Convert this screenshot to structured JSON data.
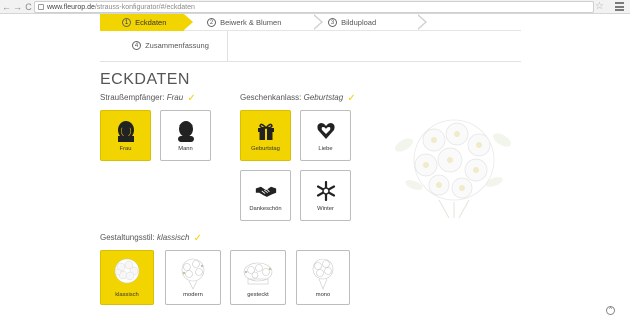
{
  "browser": {
    "back_glyph": "←",
    "forward_glyph": "→",
    "reload_glyph": "C",
    "url_host": "www.fleurop.de",
    "url_path": "/strauss-konfigurator/#/eckdaten",
    "star_glyph": "☆"
  },
  "stepper": {
    "steps": [
      {
        "num": "1",
        "label": "Eckdaten",
        "active": true
      },
      {
        "num": "2",
        "label": "Beiwerk & Blumen",
        "active": false
      },
      {
        "num": "3",
        "label": "Bildupload",
        "active": false
      },
      {
        "num": "4",
        "label": "Zusammenfassung",
        "active": false
      }
    ]
  },
  "page": {
    "title": "ECKDATEN"
  },
  "recipient": {
    "label": "Straußempfänger:",
    "value": "Frau",
    "options": [
      {
        "label": "Frau",
        "icon": "woman-icon",
        "selected": true
      },
      {
        "label": "Mann",
        "icon": "man-icon",
        "selected": false
      }
    ]
  },
  "occasion": {
    "label": "Geschenkanlass:",
    "value": "Geburtstag",
    "options": [
      {
        "label": "Geburtstag",
        "icon": "gift-icon",
        "selected": true
      },
      {
        "label": "Liebe",
        "icon": "heart-icon",
        "selected": false
      },
      {
        "label": "Dankeschön",
        "icon": "handshake-icon",
        "selected": false
      },
      {
        "label": "Winter",
        "icon": "snowflake-icon",
        "selected": false
      }
    ]
  },
  "style": {
    "label": "Gestaltungsstil:",
    "value": "klassisch",
    "options": [
      {
        "label": "klassisch",
        "icon": "bouquet-icon",
        "selected": true
      },
      {
        "label": "modern",
        "icon": "bouquet-icon",
        "selected": false
      },
      {
        "label": "gesteckt",
        "icon": "bouquet-icon",
        "selected": false
      },
      {
        "label": "mono",
        "icon": "bouquet-icon",
        "selected": false
      }
    ]
  },
  "colors": {
    "accent": "#f2d400",
    "check": "#f0d000",
    "text": "#555555",
    "border": "#bdbdbd"
  },
  "check_glyph": "✓",
  "scroll_top_glyph": "^"
}
